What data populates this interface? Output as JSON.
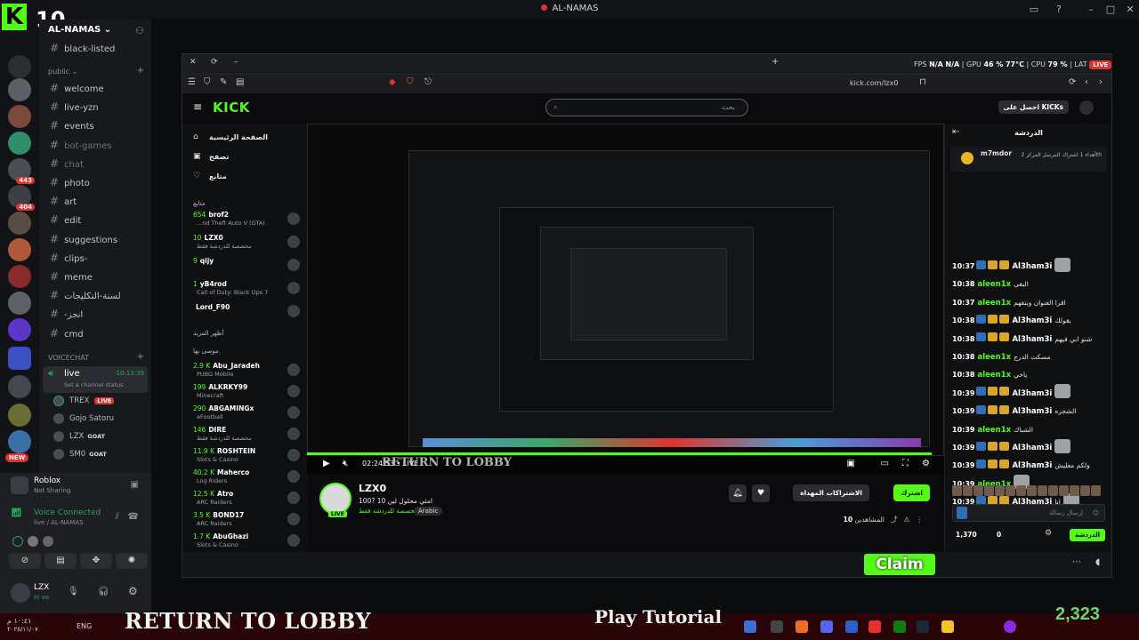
{
  "window": {
    "title": "AL-NAMAS"
  },
  "logo": {
    "letter": "K",
    "number": "10"
  },
  "server": {
    "name": "AL-NAMAS"
  },
  "channels": {
    "top_partial": "black-listed",
    "category_public": "public",
    "items": [
      {
        "name": "welcome",
        "dim": false
      },
      {
        "name": "live-yzn",
        "dim": false
      },
      {
        "name": "events",
        "dim": false
      },
      {
        "name": "bot-games",
        "dim": true
      },
      {
        "name": "chat",
        "dim": true
      },
      {
        "name": "photo",
        "dim": false
      },
      {
        "name": "art",
        "dim": false
      },
      {
        "name": "edit",
        "dim": false
      },
      {
        "name": "suggestions",
        "dim": false
      },
      {
        "name": "clips-",
        "dim": false
      },
      {
        "name": "meme",
        "dim": false
      },
      {
        "name": "لسنة-التكليجات",
        "dim": false
      },
      {
        "name": "-انجز",
        "dim": false
      },
      {
        "name": "cmd",
        "dim": false
      }
    ],
    "voice_category": "VOICECHAT",
    "voice_channel": {
      "name": "live",
      "time": "10:13:39",
      "status": "Set a channel status"
    },
    "voice_users": [
      {
        "name": "TREX",
        "badge": "LIVE"
      },
      {
        "name": "Gojo Satoru",
        "badge": ""
      },
      {
        "name": "LZX",
        "badge": "GOAT"
      },
      {
        "name": "SM0",
        "badge": "GOAT"
      }
    ]
  },
  "activity": {
    "app": "Roblox",
    "sub": "Not Sharing"
  },
  "voice_status": {
    "label": "Voice Connected",
    "channel": "live / AL-NAMAS"
  },
  "user_panel": {
    "name": "LZX",
    "status": "In vo"
  },
  "browser": {
    "url": "kick.com/lzx0",
    "perf": {
      "fps_label": "FPS",
      "fps": "N/A",
      "na": "N/A",
      "gpu_label": "GPU",
      "gpu": "46 %",
      "gpu_temp": "77°C",
      "cpu_label": "CPU",
      "cpu": "79 %",
      "lat_label": "LAT",
      "live": "LIVE"
    }
  },
  "kick": {
    "brand": "KICK",
    "search_placeholder": "بحث",
    "get_kicks": "احصل على KICKs",
    "nav": [
      {
        "label": "الصفحة الرئيسية",
        "icon": "⌂"
      },
      {
        "label": "تصفح",
        "icon": "▣"
      },
      {
        "label": "متابع",
        "icon": "♡"
      }
    ],
    "following_head": "متابع",
    "following": [
      {
        "viewers": "654",
        "name": "brof2",
        "game": "...nd Theft Auto V (GTA)"
      },
      {
        "viewers": "10",
        "name": "LZX0",
        "game": "مخصصة للدردشة فقط"
      },
      {
        "viewers": "9",
        "name": "qijy",
        "game": ""
      },
      {
        "viewers": "1",
        "name": "yB4rod",
        "game": "Call of Duty: Black Ops 7"
      },
      {
        "viewers": "",
        "name": "Lord_F90",
        "game": ""
      }
    ],
    "show_more": "أظهر المزيد",
    "recommended_head": "موصى بها",
    "recommended": [
      {
        "viewers": "2.9 K",
        "name": "Abu_Jaradeh",
        "game": "PUBG Mobile"
      },
      {
        "viewers": "199",
        "name": "ALKRKY99",
        "game": "Minecraft"
      },
      {
        "viewers": "290",
        "name": "ABGAMINGx",
        "game": "eFootball"
      },
      {
        "viewers": "146",
        "name": "DIRE",
        "game": "مخصصة للدردشة فقط"
      },
      {
        "viewers": "11.9 K",
        "name": "ROSHTEIN",
        "game": "Slots & Casino"
      },
      {
        "viewers": "40.2 K",
        "name": "Maherco",
        "game": "Log Riders"
      },
      {
        "viewers": "12.5 K",
        "name": "Atro",
        "game": "ARC Raiders"
      },
      {
        "viewers": "3.5 K",
        "name": "BOND17",
        "game": "ARC Raiders"
      },
      {
        "viewers": "1.7 K",
        "name": "AbuGhazi",
        "game": "Slots & Casino"
      }
    ],
    "player": {
      "time": "02:24:53",
      "live": "LIVE",
      "overlay": "RETURN TO LOBBY",
      "progress": 0.98
    },
    "stream": {
      "name": "LZX0",
      "live_badge": "LIVE",
      "title": "100? امثي محلول لين 10",
      "category": "مخصصة للدردشة فقط",
      "language": "Arabic",
      "follow": "اشترك",
      "gift_subs": "الاشتراكات المهداة",
      "viewers_label": "المشاهدين",
      "viewers": "10"
    },
    "chat": {
      "title": "الدردشة",
      "pinned_user": "m7mdor",
      "pinned_text": "أهداء 1 اشتراك المرسل المركز 2th",
      "messages": [
        {
          "time": "10:37",
          "user": "Al3ham3i",
          "text": "",
          "green": false,
          "emote": true
        },
        {
          "time": "10:38",
          "user": "aleen1x",
          "text": "البقى",
          "green": true,
          "emote": false
        },
        {
          "time": "10:37",
          "user": "aleen1x",
          "text": "اقرا العنوان وبتفهم",
          "green": true,
          "emote": false
        },
        {
          "time": "10:38",
          "user": "Al3ham3i",
          "text": "بقولك",
          "green": false,
          "emote": false
        },
        {
          "time": "10:38",
          "user": "Al3ham3i",
          "text": "شنو ابي فيهم",
          "green": false,
          "emote": false
        },
        {
          "time": "10:38",
          "user": "aleen1x",
          "text": "مسكت الدرج",
          "green": true,
          "emote": false
        },
        {
          "time": "10:38",
          "user": "aleen1x",
          "text": "ياخي",
          "green": true,
          "emote": false
        },
        {
          "time": "10:39",
          "user": "Al3ham3i",
          "text": "",
          "green": false,
          "emote": true
        },
        {
          "time": "10:39",
          "user": "Al3ham3i",
          "text": "الشجره",
          "green": false,
          "emote": false
        },
        {
          "time": "10:39",
          "user": "aleen1x",
          "text": "الشباك",
          "green": true,
          "emote": false
        },
        {
          "time": "10:39",
          "user": "Al3ham3i",
          "text": "",
          "green": false,
          "emote": true
        },
        {
          "time": "10:39",
          "user": "Al3ham3i",
          "text": "ولكم معليش",
          "green": false,
          "emote": false
        },
        {
          "time": "10:39",
          "user": "aleen1x",
          "text": "",
          "green": true,
          "emote": true
        },
        {
          "time": "10:39",
          "user": "Al3ham3i",
          "text": "انا",
          "green": false,
          "emote": true
        }
      ],
      "input_placeholder": "إرسال رسالة",
      "points": "1,370",
      "zero": "0",
      "send": "الدردشة"
    },
    "claim": "Claim"
  },
  "taskbar": {
    "time": "١٠:٤١ م",
    "date": "٢٠٢٥/١١/٠٧",
    "lang": "ENG",
    "overlay": "RETURN TO LOBBY",
    "overlay2": "Play Tutorial",
    "counter": "2,323"
  }
}
